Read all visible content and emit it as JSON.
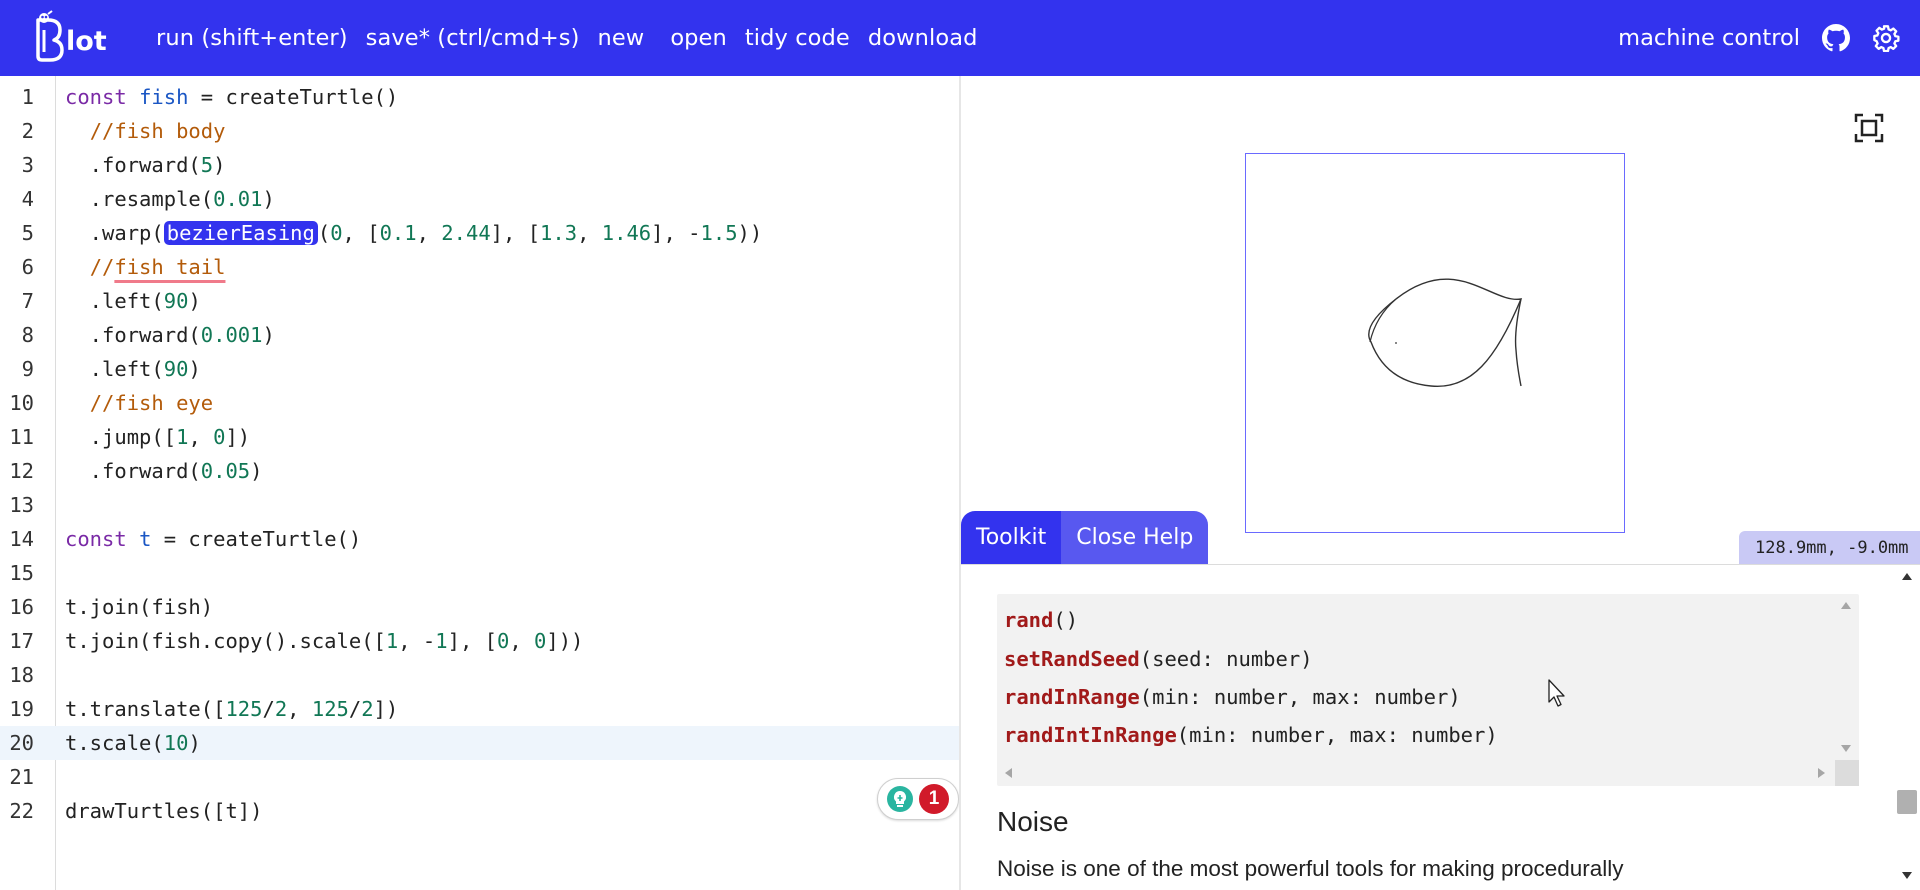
{
  "topbar": {
    "logo_text": "Blot",
    "nav": [
      "run (shift+enter)",
      "save* (ctrl/cmd+s)",
      "new",
      "open",
      "tidy code",
      "download"
    ],
    "machine_control": "machine control",
    "github_icon": "github-icon",
    "settings_icon": "gear-icon"
  },
  "editor": {
    "line_numbers": [
      "1",
      "2",
      "3",
      "4",
      "5",
      "6",
      "7",
      "8",
      "9",
      "10",
      "11",
      "12",
      "13",
      "14",
      "15",
      "16",
      "17",
      "18",
      "19",
      "20",
      "21",
      "22"
    ],
    "active_line": 20,
    "lines": {
      "l1": {
        "a": "const ",
        "b": "fish",
        "c": " = createTurtle()"
      },
      "l2": {
        "a": "  ",
        "b": "//fish body"
      },
      "l3": {
        "a": "  .forward(",
        "b": "5",
        "c": ")"
      },
      "l4": {
        "a": "  .resample(",
        "b": "0.01",
        "c": ")"
      },
      "l5": {
        "a": "  .warp(",
        "b": "bezierEasing",
        "c": "(",
        "d": "0",
        "e": ", [",
        "f": "0.1",
        "g": ", ",
        "h": "2.44",
        "i": "], [",
        "j": "1.3",
        "k": ", ",
        "l": "1.46",
        "m": "], -",
        "n": "1.5",
        "o": "))"
      },
      "l6": {
        "a": "  ",
        "b": "//",
        "c": "fish tail"
      },
      "l7": {
        "a": "  .left(",
        "b": "90",
        "c": ")"
      },
      "l8": {
        "a": "  .forward(",
        "b": "0.001",
        "c": ")"
      },
      "l9": {
        "a": "  .left(",
        "b": "90",
        "c": ")"
      },
      "l10": {
        "a": "  ",
        "b": "//fish eye"
      },
      "l11": {
        "a": "  .jump([",
        "b": "1",
        "c": ", ",
        "d": "0",
        "e": "])"
      },
      "l12": {
        "a": "  .forward(",
        "b": "0.05",
        "c": ")"
      },
      "l14": {
        "a": "const ",
        "b": "t",
        "c": " = createTurtle()"
      },
      "l16": {
        "a": "t.join(fish)"
      },
      "l17": {
        "a": "t.join(fish.copy().scale([",
        "b": "1",
        "c": ", -",
        "d": "1",
        "e": "], [",
        "f": "0",
        "g": ", ",
        "h": "0",
        "i": "]))"
      },
      "l19": {
        "a": "t.translate([",
        "b": "125",
        "c": "/",
        "d": "2",
        "e": ", ",
        "f": "125",
        "g": "/",
        "h": "2",
        "i": "])"
      },
      "l20": {
        "a": "t.scale(",
        "b": "10",
        "c": ")"
      },
      "l22": {
        "a": "drawTurtles([t])"
      }
    },
    "lint_count": "1"
  },
  "preview": {
    "coords": "128.9mm, -9.0mm",
    "fullscreen_icon": "fullscreen-icon"
  },
  "help": {
    "tabs": [
      "Toolkit",
      "Close Help"
    ],
    "code_lines": [
      {
        "fn": "rand",
        "args": "()"
      },
      {
        "fn": "setRandSeed",
        "args": "(seed: number)"
      },
      {
        "fn": "randInRange",
        "args": "(min: number, max: number)"
      },
      {
        "fn": "randIntInRange",
        "args": "(min: number, max: number)"
      }
    ],
    "section_title": "Noise",
    "section_text": "Noise is one of the most powerful tools for making procedurally"
  },
  "colors": {
    "brand": "#3333ee",
    "canvas_border": "#6a6aff",
    "lint_error": "#d11a2a"
  }
}
